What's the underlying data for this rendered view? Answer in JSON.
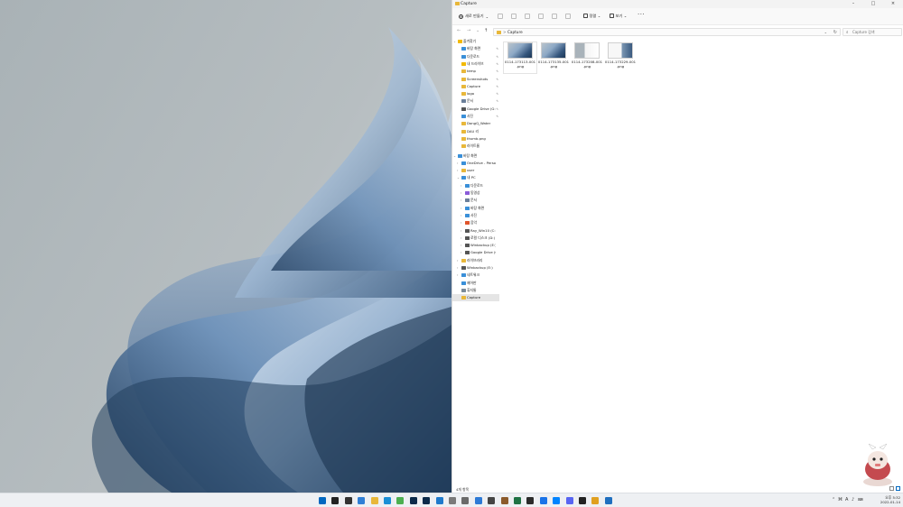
{
  "window": {
    "title": "Capture"
  },
  "command_bar": {
    "new_label": "새로 만들기",
    "sort_label": "정렬",
    "view_label": "보기",
    "more_label": "···"
  },
  "address": {
    "path": "Capture",
    "separator": ">"
  },
  "search": {
    "placeholder": "Capture 검색"
  },
  "nav": {
    "quick_access": "즐겨찾기",
    "pinned": [
      {
        "label": "바탕 화면",
        "icon": "desktop-folder-icon",
        "color": "#3a8fd8"
      },
      {
        "label": "다운로드",
        "icon": "download-icon",
        "color": "#3a8fd8"
      },
      {
        "label": "내 드라이브",
        "icon": "drive-icon",
        "color": "#f2b900"
      },
      {
        "label": "temp",
        "icon": "folder-icon",
        "color": "#e8b73a"
      },
      {
        "label": "Screenshots",
        "icon": "folder-icon",
        "color": "#e8b73a"
      },
      {
        "label": "Capture",
        "icon": "folder-icon",
        "color": "#e8b73a"
      },
      {
        "label": "logo",
        "icon": "folder-icon",
        "color": "#e8b73a"
      },
      {
        "label": "문서",
        "icon": "document-icon",
        "color": "#6b7f99"
      },
      {
        "label": "Google Drive (G:)",
        "icon": "drive-icon",
        "color": "#555555"
      },
      {
        "label": "사진",
        "icon": "pictures-icon",
        "color": "#3a8fd8"
      }
    ],
    "recent": [
      {
        "label": "DongQ_Water",
        "icon": "folder-icon",
        "color": "#e8b73a"
      },
      {
        "label": "DAU 리",
        "icon": "folder-icon",
        "color": "#e8b73a"
      },
      {
        "label": "thumb.png",
        "icon": "folder-icon",
        "color": "#e8b73a"
      },
      {
        "label": "라이트룸",
        "icon": "folder-icon",
        "color": "#e8b73a"
      }
    ],
    "desktop_root": "바탕 화면",
    "onedrive": "OneDrive - Person",
    "user": "user",
    "this_pc": "내 PC",
    "pc_items": [
      {
        "label": "다운로드",
        "icon": "download-icon",
        "color": "#3a8fd8"
      },
      {
        "label": "동영상",
        "icon": "video-icon",
        "color": "#8a5cd8"
      },
      {
        "label": "문서",
        "icon": "document-icon",
        "color": "#6b7f99"
      },
      {
        "label": "바탕 화면",
        "icon": "desktop-folder-icon",
        "color": "#3a8fd8"
      },
      {
        "label": "사진",
        "icon": "pictures-icon",
        "color": "#3a8fd8"
      },
      {
        "label": "음악",
        "icon": "music-icon",
        "color": "#e0552b"
      },
      {
        "label": "Ray_Win10 (C:)",
        "icon": "drive-icon",
        "color": "#555555"
      },
      {
        "label": "로컬 디스크 (D:)",
        "icon": "drive-icon",
        "color": "#555555"
      },
      {
        "label": "Winbackup (E:)",
        "icon": "drive-icon",
        "color": "#555555"
      },
      {
        "label": "Google Drive (G:)",
        "icon": "drive-icon",
        "color": "#555555"
      }
    ],
    "tail": [
      {
        "label": "라이브러리",
        "icon": "library-icon",
        "color": "#e8b73a"
      },
      {
        "label": "Winbackup (E:)",
        "icon": "drive-icon",
        "color": "#555555"
      },
      {
        "label": "네트워크",
        "icon": "network-icon",
        "color": "#3a8fd8"
      },
      {
        "label": "제어판",
        "icon": "control-panel-icon",
        "color": "#3a8fd8"
      },
      {
        "label": "휴지통",
        "icon": "recycle-bin-icon",
        "color": "#7a8a99"
      },
      {
        "label": "Capture",
        "icon": "folder-icon",
        "color": "#e8b73a"
      }
    ]
  },
  "files": [
    {
      "name": "0114-173113-001.png",
      "line1": "0114-173113-001",
      "line2": ".png",
      "preview": "wallpaper"
    },
    {
      "name": "0114-173135-001.png",
      "line1": "0114-173135-001",
      "line2": ".png",
      "preview": "wallpaper"
    },
    {
      "name": "0114-173208-001.png",
      "line1": "0114-173208-001",
      "line2": ".png",
      "preview": "window"
    },
    {
      "name": "0114-173229-001.png",
      "line1": "0114-173229-001",
      "line2": ".png",
      "preview": "mixed"
    }
  ],
  "status": {
    "count": "4개 항목"
  },
  "tray": {
    "lang": "A",
    "time": "오후 5:32",
    "date": "2022-01-14"
  },
  "colors": {
    "accent": "#0067c0",
    "folder": "#e8b73a",
    "wallpaper_blue": "#4a6f95"
  }
}
